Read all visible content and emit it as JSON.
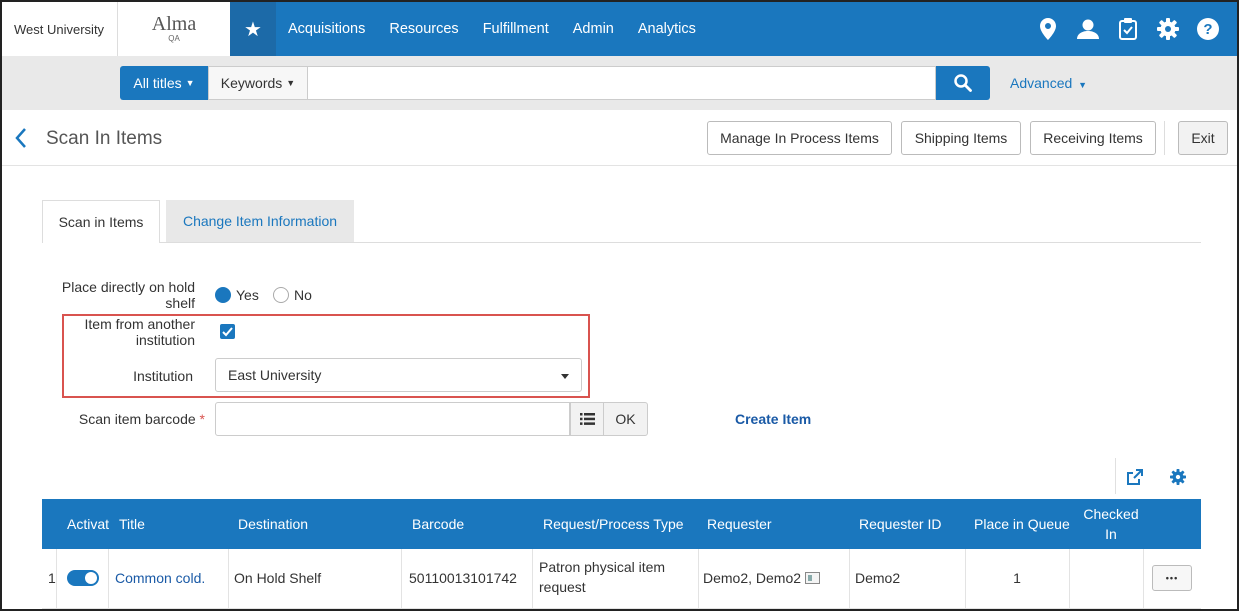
{
  "header": {
    "institution": "West University",
    "logo": "Alma",
    "environment": "QA",
    "nav": [
      "Acquisitions",
      "Resources",
      "Fulfillment",
      "Admin",
      "Analytics"
    ],
    "icons": [
      "location-icon",
      "user-icon",
      "tasks-icon",
      "gear-icon",
      "help-icon"
    ]
  },
  "search": {
    "scope": "All titles",
    "field": "Keywords",
    "query": "",
    "advanced": "Advanced"
  },
  "page": {
    "title": "Scan In Items",
    "buttons": {
      "manage": "Manage In Process Items",
      "shipping": "Shipping Items",
      "receiving": "Receiving Items",
      "exit": "Exit"
    }
  },
  "tabs": {
    "scan": "Scan in Items",
    "change": "Change Item Information"
  },
  "form": {
    "hold_shelf_label_1": "Place directly on hold",
    "hold_shelf_label_2": "shelf",
    "yes": "Yes",
    "no": "No",
    "another_inst_label_1": "Item from another",
    "another_inst_label_2": "institution",
    "institution_label": "Institution",
    "institution_value": "East University",
    "barcode_label": "Scan item barcode",
    "required_mark": "*",
    "barcode_value": "",
    "ok": "OK",
    "create_item": "Create Item"
  },
  "table": {
    "columns": {
      "active": "Activat",
      "title": "Title",
      "destination": "Destination",
      "barcode": "Barcode",
      "request_type": "Request/Process Type",
      "requester": "Requester",
      "requester_id": "Requester ID",
      "place_in_queue": "Place in Queue",
      "checked_in_1": "Checked",
      "checked_in_2": "In"
    },
    "rows": [
      {
        "num": "1",
        "title": "Common cold.",
        "destination": "On Hold Shelf",
        "barcode": "50110013101742",
        "request_type_1": "Patron physical item",
        "request_type_2": "request",
        "requester": "Demo2, Demo2",
        "requester_id": "Demo2",
        "place_in_queue": "1",
        "checked_in": "",
        "more": "•••"
      }
    ]
  },
  "colors": {
    "brand": "#1a77be",
    "highlight_border": "#d9534f",
    "link": "#1a5aa6"
  }
}
